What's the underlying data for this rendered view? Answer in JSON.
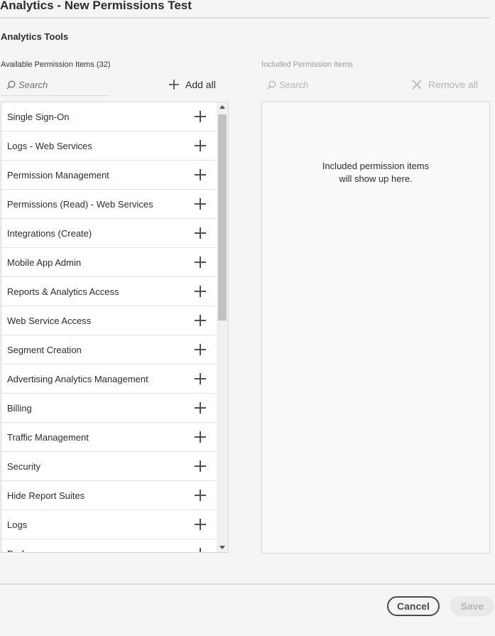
{
  "dialog": {
    "title": "Analytics - New Permissions Test",
    "section_title": "Analytics Tools"
  },
  "available": {
    "label": "Available Permission Items (32)",
    "search_placeholder": "Search",
    "add_all_label": "Add all",
    "items": [
      "Single Sign-On",
      "Logs - Web Services",
      "Permission Management",
      "Permissions (Read) - Web Services",
      "Integrations (Create)",
      "Mobile App Admin",
      "Reports & Analytics Access",
      "Web Service Access",
      "Segment Creation",
      "Advertising Analytics Management",
      "Billing",
      "Traffic Management",
      "Security",
      "Hide Report Suites",
      "Logs",
      "Prof"
    ]
  },
  "included": {
    "label": "Included Permission Items",
    "search_placeholder": "Search",
    "remove_all_label": "Remove all",
    "empty_message": "Included permission items\nwill show up here."
  },
  "footer": {
    "cancel_label": "Cancel",
    "save_label": "Save"
  },
  "icons": {
    "search": "search-icon",
    "add": "plus-icon",
    "remove": "close-icon"
  }
}
